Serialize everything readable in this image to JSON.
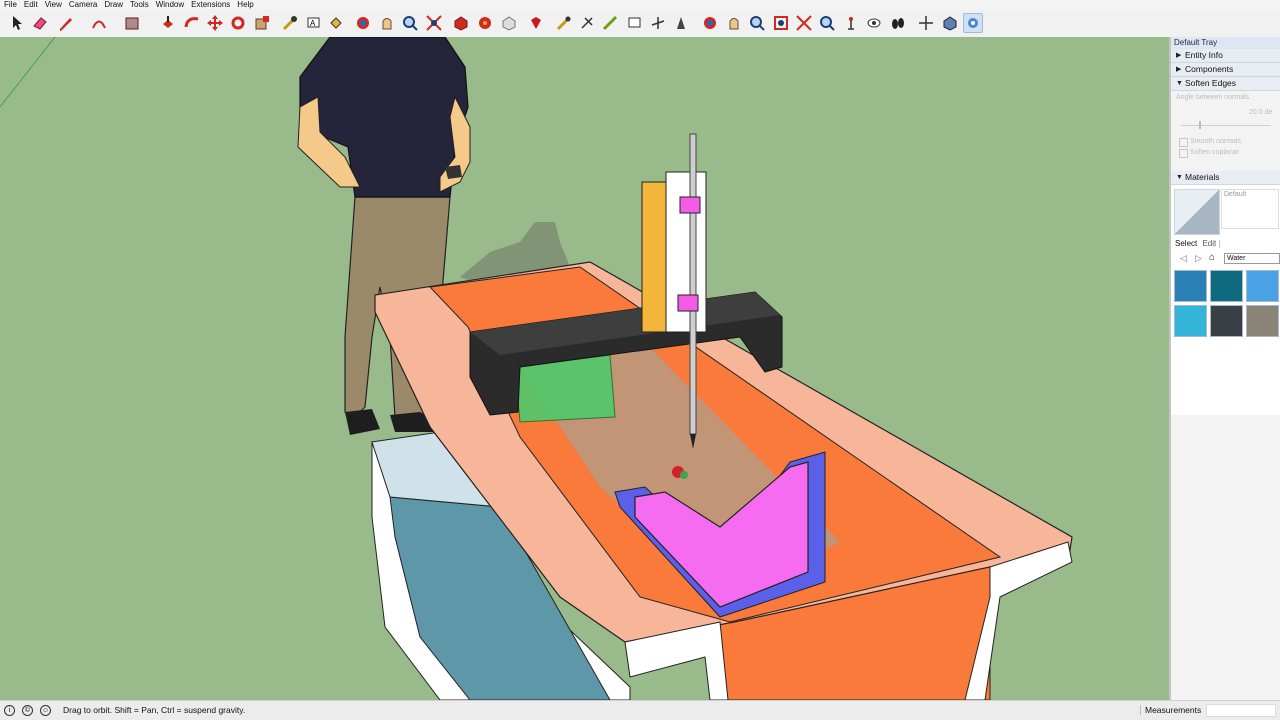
{
  "menu": [
    "File",
    "Edit",
    "View",
    "Camera",
    "Draw",
    "Tools",
    "Window",
    "Extensions",
    "Help"
  ],
  "toolbar_tools": [
    "select-icon",
    "eraser-icon",
    "pencil-line-icon",
    "arc-icon",
    "rectangle-icon",
    "push-pull-icon",
    "follow-me-icon",
    "move-icon",
    "rotate-icon",
    "scale-icon",
    "tape-measure-icon",
    "text-icon",
    "paint-bucket-icon",
    "orbit-icon",
    "pan-icon",
    "zoom-icon",
    "zoom-extents-icon",
    "components-icon",
    "warehouse-icon",
    "extension-icon",
    "ruby-icon",
    "sandbox-icon",
    "section-icon",
    "dimension-icon",
    "protractor-icon",
    "axes-icon",
    "3d-text-icon",
    "walk-icon",
    "look-around-icon",
    "position-camera-icon",
    "zoom-window-icon",
    "previous-view-icon",
    "next-view-icon",
    "styles-icon",
    "shadows-icon",
    "fog-icon",
    "match-photo-icon",
    "solar-icon"
  ],
  "tray": {
    "title": "Default Tray",
    "entity_info": "Entity Info",
    "components": "Components",
    "soften_edges": "Soften Edges",
    "angle_label": "Angle between normals",
    "angle_value": "20.0",
    "angle_unit": "de",
    "smooth_normals": "Smooth normals",
    "soften_coplanar": "Soften coplanar",
    "materials": "Materials",
    "material_name": "Default",
    "tab_select": "Select",
    "tab_edit": "Edit",
    "library": "Water",
    "swatches": [
      "#2a7fb5",
      "#0f6a80",
      "#4aa2e6",
      "#34b4d8",
      "#3a3f45",
      "#8a8377"
    ]
  },
  "status": {
    "hint": "Drag to orbit. Shift = Pan, Ctrl = suspend gravity.",
    "measurements_label": "Measurements"
  },
  "colors": {
    "viewport_bg": "#99bb8b",
    "tank_rim": "#f6b49a",
    "tank_inner": "#f97a3a",
    "carriage": "#2b2b2b",
    "model_magenta": "#f66cf0",
    "model_blue": "#5b60e8"
  }
}
